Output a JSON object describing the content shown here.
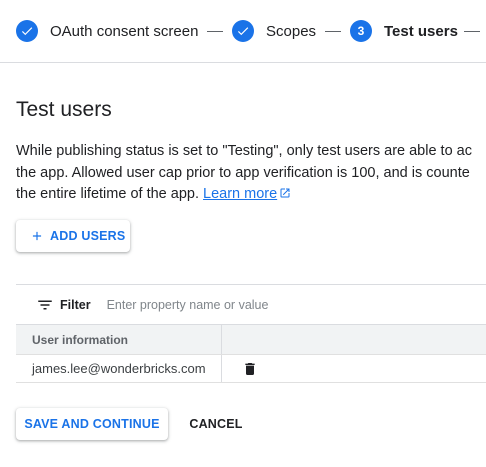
{
  "stepper": {
    "steps": [
      {
        "label": "OAuth consent screen",
        "state": "done"
      },
      {
        "label": "Scopes",
        "state": "done"
      },
      {
        "label": "Test users",
        "state": "active",
        "number": "3"
      }
    ]
  },
  "section": {
    "title": "Test users",
    "description_lines": [
      "While publishing status is set to \"Testing\", only test users are able to ac",
      "the app. Allowed user cap prior to app verification is 100, and is counte",
      "the entire lifetime of the app."
    ],
    "learn_more": "Learn more",
    "add_users_label": "ADD USERS"
  },
  "table": {
    "filter_label": "Filter",
    "filter_placeholder": "Enter property name or value",
    "columns": [
      "User information",
      ""
    ],
    "rows": [
      {
        "email": "james.lee@wonderbricks.com"
      }
    ]
  },
  "actions": {
    "save_label": "SAVE AND CONTINUE",
    "cancel_label": "CANCEL"
  },
  "colors": {
    "accent": "#1a73e8",
    "text": "#202124",
    "muted": "#5f6368",
    "divider": "#dadce0"
  },
  "icons": [
    "check-icon",
    "check-icon",
    "plus-icon",
    "filter-icon",
    "trash-icon",
    "external-link-icon"
  ]
}
